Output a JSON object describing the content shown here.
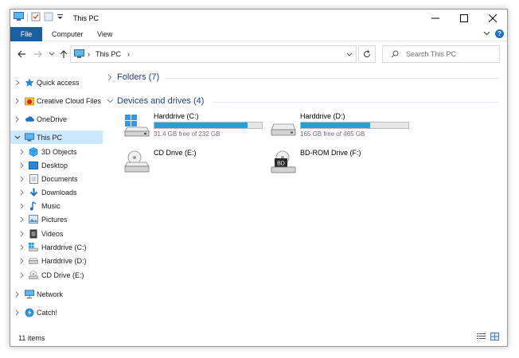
{
  "window": {
    "title": "This PC"
  },
  "ribbon": {
    "tabs": [
      "File",
      "Computer",
      "View"
    ]
  },
  "address": {
    "crumb": "This PC"
  },
  "search": {
    "placeholder": "Search This PC"
  },
  "nav": {
    "items": [
      {
        "label": "Quick access",
        "icon": "star-icon"
      },
      {
        "label": "Creative Cloud Files",
        "icon": "creative-cloud-icon"
      },
      {
        "label": "OneDrive",
        "icon": "cloud-icon"
      },
      {
        "label": "This PC",
        "icon": "computer-icon"
      },
      {
        "label": "3D Objects",
        "icon": "cube-icon"
      },
      {
        "label": "Desktop",
        "icon": "desktop-icon"
      },
      {
        "label": "Documents",
        "icon": "document-icon"
      },
      {
        "label": "Downloads",
        "icon": "download-icon"
      },
      {
        "label": "Music",
        "icon": "music-icon"
      },
      {
        "label": "Pictures",
        "icon": "picture-icon"
      },
      {
        "label": "Videos",
        "icon": "video-icon"
      },
      {
        "label": "Harddrive (C:)",
        "icon": "drive-icon"
      },
      {
        "label": "Harddrive (D:)",
        "icon": "drive-icon"
      },
      {
        "label": "CD Drive (E:)",
        "icon": "cd-icon"
      },
      {
        "label": "Network",
        "icon": "network-icon"
      },
      {
        "label": "Catch!",
        "icon": "catch-icon"
      }
    ]
  },
  "content": {
    "folders_header": "Folders (7)",
    "devices_header": "Devices and drives (4)",
    "drives": [
      {
        "name": "Harddrive (C:)",
        "free": "31.4 GB free of 232 GB",
        "used_fraction": 0.865,
        "icon": "windows-drive-icon"
      },
      {
        "name": "Harddrive (D:)",
        "free": "165 GB free of 465 GB",
        "used_fraction": 0.645,
        "icon": "hard-drive-icon"
      },
      {
        "name": "CD Drive (E:)",
        "icon": "cd-drive-icon"
      },
      {
        "name": "BD-ROM Drive (F:)",
        "icon": "bd-rom-drive-icon",
        "badge": "BD"
      }
    ]
  },
  "status": {
    "count": "11 items"
  },
  "colors": {
    "accent": "#1d5e9e",
    "selection": "#cce8ff",
    "bar_fill": "#26a0da",
    "header": "#1e3f8a"
  }
}
